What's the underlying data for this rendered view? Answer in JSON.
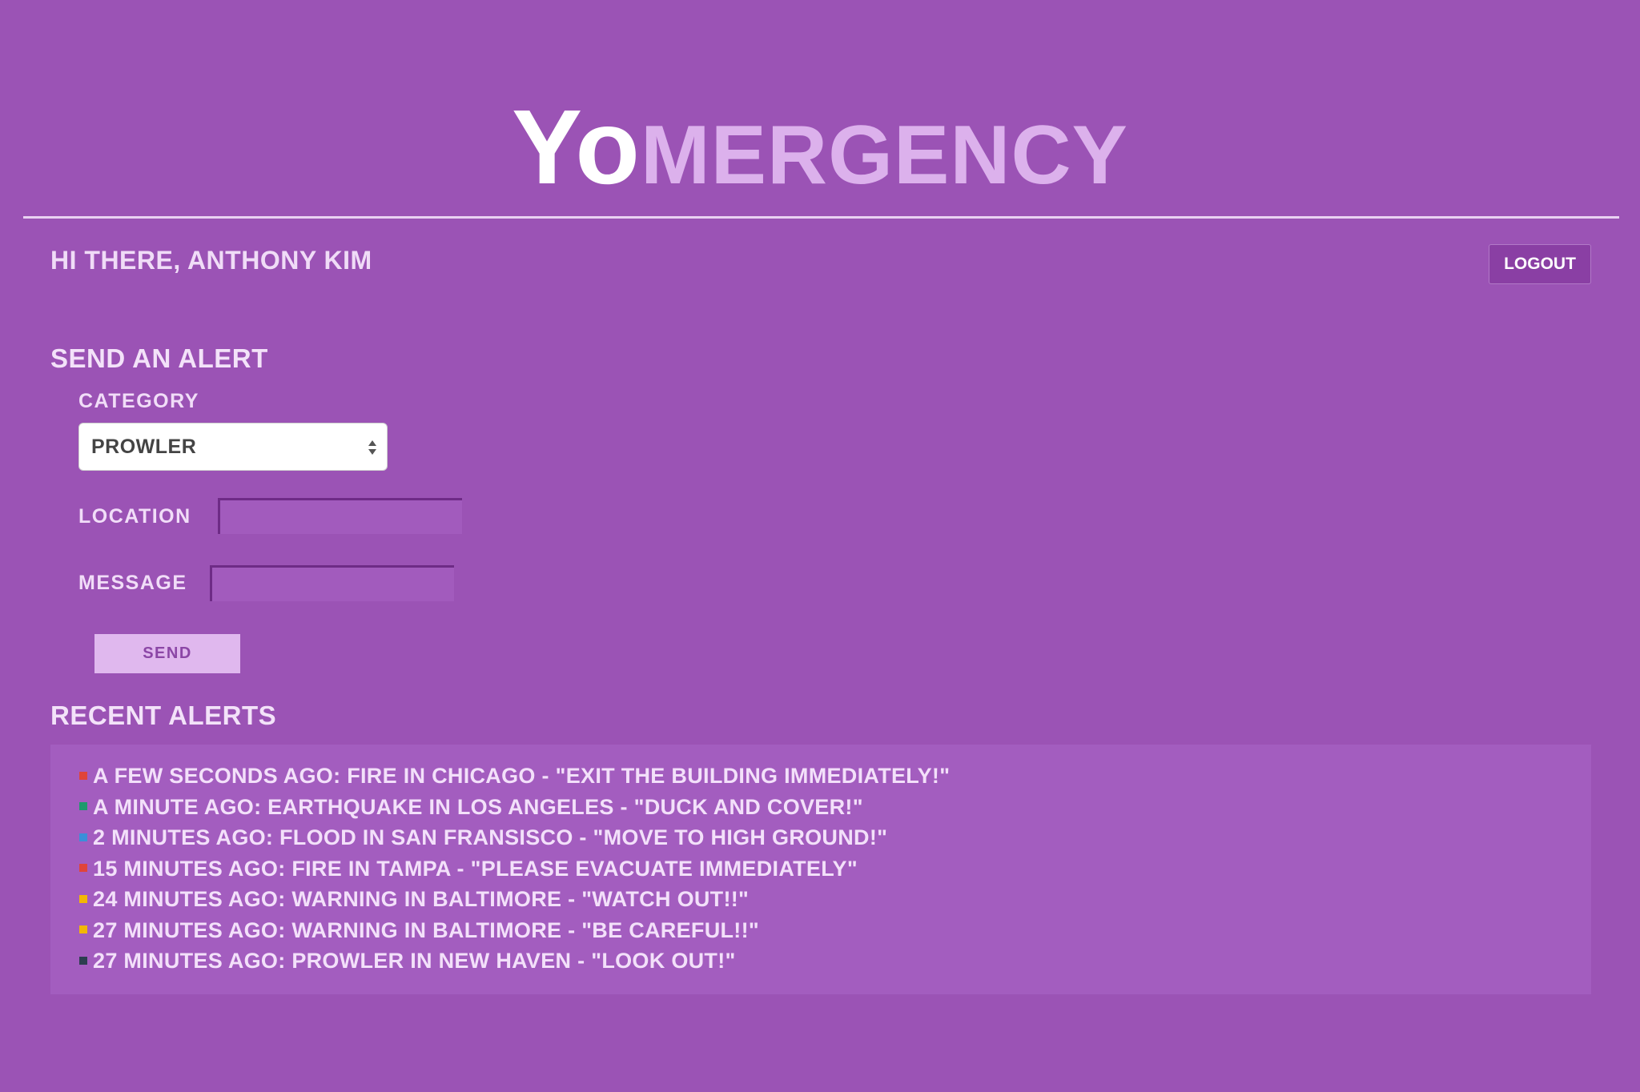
{
  "app": {
    "logo_part1": "Yo",
    "logo_part2": "MERGENCY"
  },
  "user": {
    "greeting": "HI THERE, ANTHONY KIM",
    "logout_label": "LOGOUT"
  },
  "send_alert": {
    "title": "SEND AN ALERT",
    "category_label": "CATEGORY",
    "category_value": "PROWLER",
    "location_label": "LOCATION",
    "location_value": "",
    "message_label": "MESSAGE",
    "message_value": "",
    "send_label": "SEND"
  },
  "recent_alerts": {
    "title": "RECENT ALERTS",
    "items": [
      {
        "text": "A FEW SECONDS AGO: FIRE IN CHICAGO - \"EXIT THE BUILDING IMMEDIATELY!\"",
        "color": "#e0443a"
      },
      {
        "text": "A MINUTE AGO: EARTHQUAKE IN LOS ANGELES - \"DUCK AND COVER!\"",
        "color": "#1d9a6c"
      },
      {
        "text": "2 MINUTES AGO: FLOOD IN SAN FRANSISCO - \"MOVE TO HIGH GROUND!\"",
        "color": "#3b8fd9"
      },
      {
        "text": "15 MINUTES AGO: FIRE IN TAMPA - \"PLEASE EVACUATE IMMEDIATELY\"",
        "color": "#e0443a"
      },
      {
        "text": "24 MINUTES AGO: WARNING IN BALTIMORE - \"WATCH OUT!!\"",
        "color": "#f2b705"
      },
      {
        "text": "27 MINUTES AGO: WARNING IN BALTIMORE - \"BE CAREFUL!!\"",
        "color": "#f2b705"
      },
      {
        "text": "27 MINUTES AGO: PROWLER IN NEW HAVEN - \"LOOK OUT!\"",
        "color": "#2c3e50"
      }
    ]
  }
}
